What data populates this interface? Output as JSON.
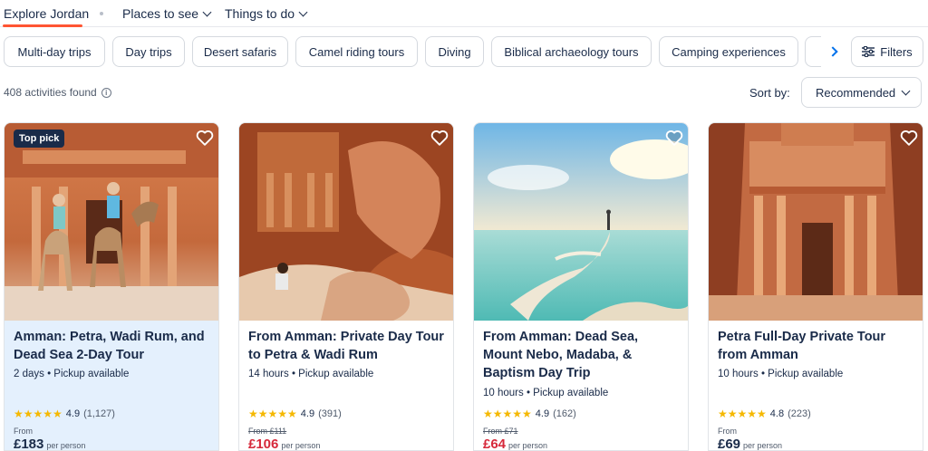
{
  "nav": {
    "explore": "Explore Jordan",
    "places": "Places to see",
    "things": "Things to do"
  },
  "chips": [
    "Multi-day trips",
    "Day trips",
    "Desert safaris",
    "Camel riding tours",
    "Diving",
    "Biblical archaeology tours",
    "Camping experiences"
  ],
  "filters_label": "Filters",
  "results": {
    "count": "408 activities found",
    "sort_label": "Sort by:",
    "sort_value": "Recommended"
  },
  "cards": [
    {
      "badge": "Top pick",
      "title": "Amman: Petra, Wadi Rum, and Dead Sea 2-Day Tour",
      "meta": "2 days • Pickup available",
      "stars": "★★★★★",
      "rating": "4.9",
      "reviews": "(1,127)",
      "from": "From",
      "price": "£183",
      "per": "per person"
    },
    {
      "title": "From Amman: Private Day Tour to Petra & Wadi Rum",
      "meta": "14 hours • Pickup available",
      "stars": "★★★★★",
      "rating": "4.9",
      "reviews": "(391)",
      "from": "From £111",
      "price": "£106",
      "per": "per person"
    },
    {
      "title": "From Amman: Dead Sea, Mount Nebo, Madaba, & Baptism Day Trip",
      "meta": "10 hours • Pickup available",
      "stars": "★★★★★",
      "rating": "4.9",
      "reviews": "(162)",
      "from": "From £71",
      "price": "£64",
      "per": "per person"
    },
    {
      "title": "Petra Full-Day Private Tour from Amman",
      "meta": "10 hours • Pickup available",
      "stars": "★★★★★",
      "rating": "4.8",
      "reviews": "(223)",
      "from": "From",
      "price": "£69",
      "per": "per person"
    }
  ],
  "colors": {
    "accent": "#ff5533",
    "brand_dark": "#1a2b49",
    "link_blue": "#0071eb",
    "sale_red": "#d6283a",
    "star": "#f5b800",
    "highlight_card": "#e4f0fd"
  },
  "icons": [
    "chevron-down-icon",
    "chevron-right-icon",
    "filters-sliders-icon",
    "info-icon",
    "heart-icon",
    "star-icon"
  ]
}
